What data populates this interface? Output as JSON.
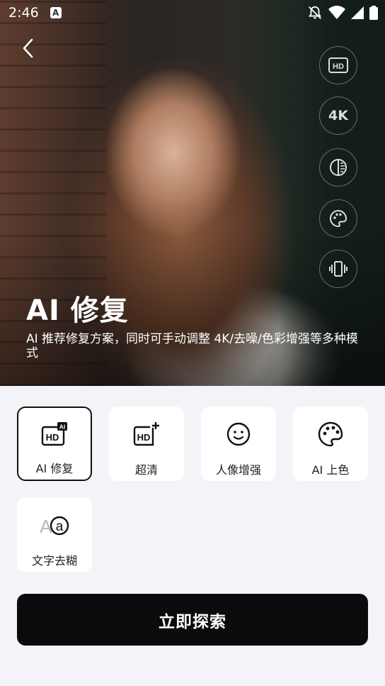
{
  "status_bar": {
    "time": "2:46",
    "notification_letter": "A"
  },
  "hero": {
    "title": "AI 修复",
    "description": "AI 推荐修复方案，同时可手动调整 4K/去噪/色彩增强等多种模式",
    "tools": [
      {
        "icon": "hd-icon",
        "label": "HD"
      },
      {
        "icon": "4k-icon",
        "label": "4K"
      },
      {
        "icon": "contrast-icon",
        "label": ""
      },
      {
        "icon": "palette-icon",
        "label": ""
      },
      {
        "icon": "vibrate-icon",
        "label": ""
      }
    ]
  },
  "features": [
    {
      "label": "AI 修复",
      "icon": "ai-hd-icon",
      "selected": true
    },
    {
      "label": "超清",
      "icon": "hd-plus-icon",
      "selected": false
    },
    {
      "label": "人像增强",
      "icon": "face-icon",
      "selected": false
    },
    {
      "label": "AI 上色",
      "icon": "palette-icon",
      "selected": false
    },
    {
      "label": "文字去糊",
      "icon": "text-deblur-icon",
      "selected": false
    }
  ],
  "cta": {
    "label": "立即探索"
  },
  "colors": {
    "primary": "#0b0b0e",
    "background": "#f3f3f8",
    "card": "#ffffff"
  }
}
